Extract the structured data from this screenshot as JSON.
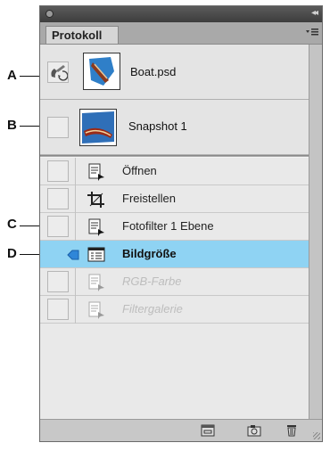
{
  "panel": {
    "tab_label": "Protokoll",
    "snapshots": [
      {
        "label": "Boat.psd",
        "source_icon": "history-brush-icon"
      },
      {
        "label": "Snapshot 1"
      }
    ],
    "history": [
      {
        "label": "Öffnen",
        "icon": "history-state-icon",
        "state": "normal"
      },
      {
        "label": "Freistellen",
        "icon": "crop-icon",
        "state": "normal"
      },
      {
        "label": "Fotofilter 1 Ebene",
        "icon": "history-state-icon",
        "state": "normal"
      },
      {
        "label": "Bildgröße",
        "icon": "dialog-state-icon",
        "state": "selected"
      },
      {
        "label": "RGB-Farbe",
        "icon": "history-state-icon",
        "state": "dimmed"
      },
      {
        "label": "Filtergalerie",
        "icon": "history-state-icon",
        "state": "dimmed"
      }
    ],
    "footer_buttons": [
      "new-document-from-state-icon",
      "new-snapshot-icon",
      "trash-icon"
    ],
    "selection_color": "#8fd3f3"
  },
  "callouts": [
    "A",
    "B",
    "C",
    "D"
  ]
}
